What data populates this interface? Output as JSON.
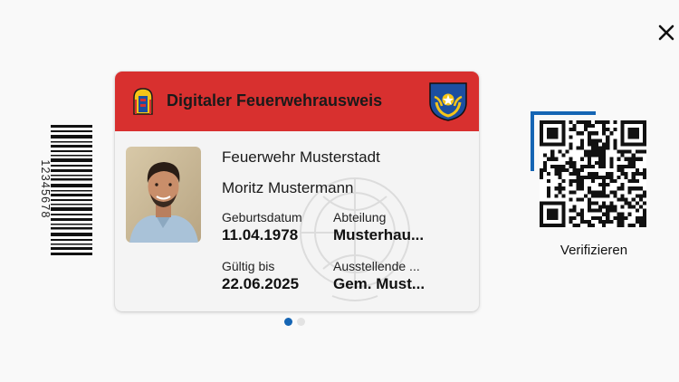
{
  "close": {
    "icon": "close-icon"
  },
  "barcode": {
    "number": "12345678"
  },
  "card": {
    "title": "Digitaler Feuerwehrausweis",
    "header_color": "#d8302f",
    "organization": "Feuerwehr Musterstadt",
    "name": "Moritz Mustermann",
    "fields": {
      "birthdate_label": "Geburtsdatum",
      "birthdate_value": "11.04.1978",
      "department_label": "Abteilung",
      "department_value": "Musterhau...",
      "valid_label": "Gültig bis",
      "valid_value": "22.06.2025",
      "issuer_label": "Ausstellende ...",
      "issuer_value": "Gem. Must..."
    }
  },
  "pagination": {
    "active_color": "#1565b4",
    "inactive_color": "#e3e3e3"
  },
  "qr": {
    "verify_label": "Verifizieren",
    "frame_color": "#1565b4"
  }
}
